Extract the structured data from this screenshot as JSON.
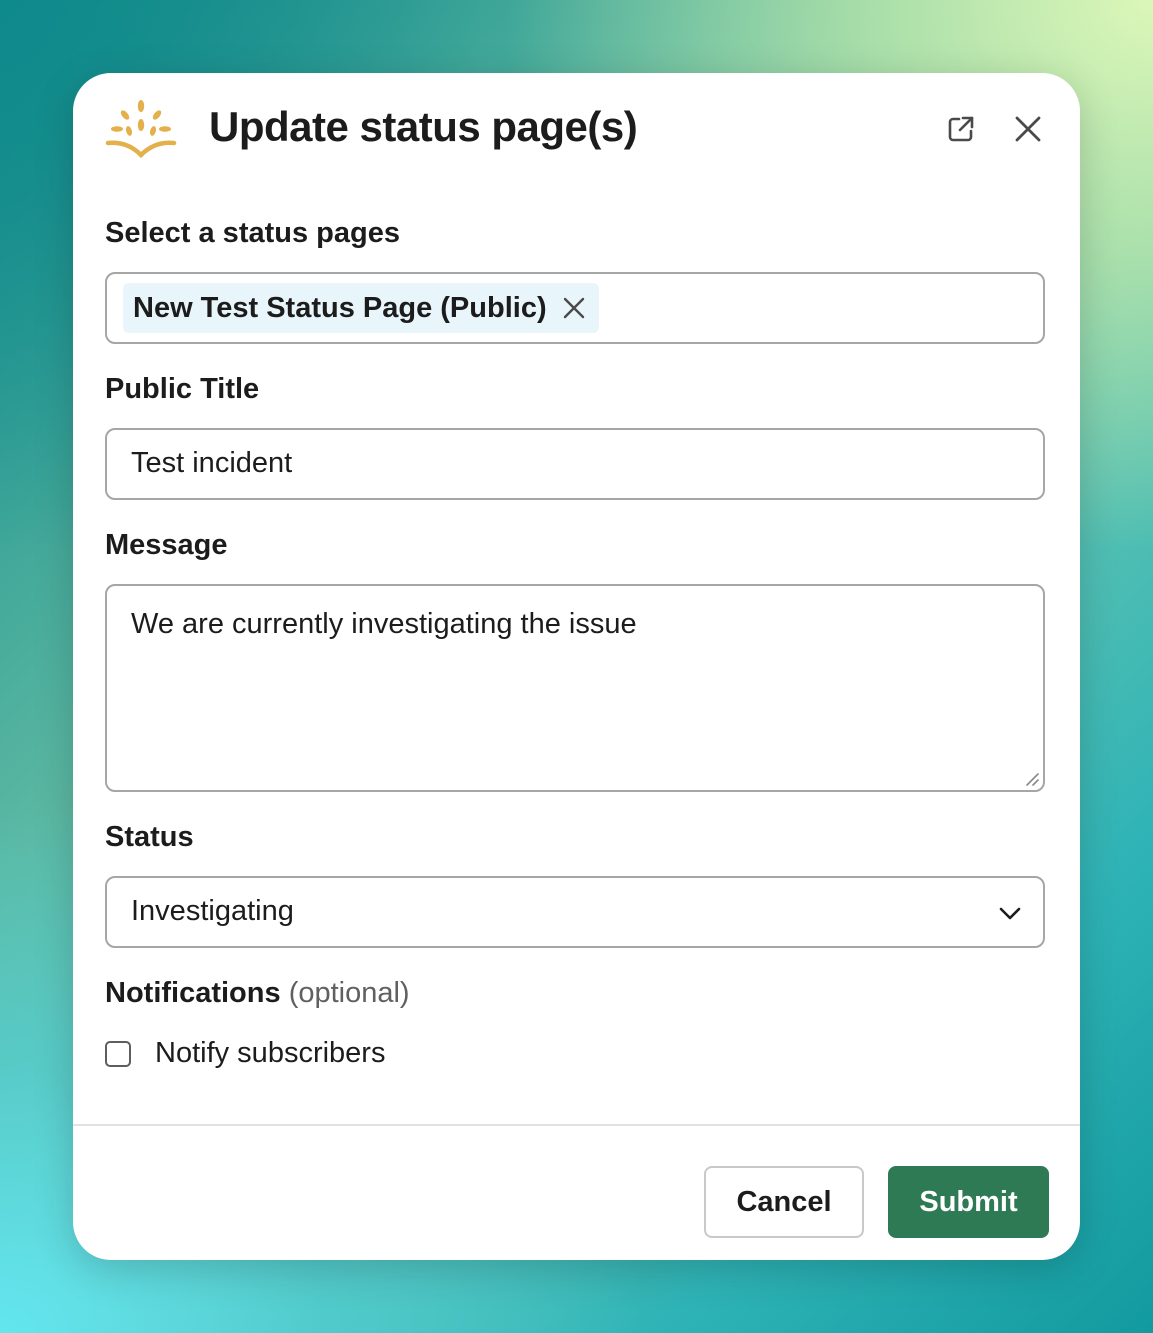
{
  "modal": {
    "title": "Update status page(s)",
    "logo_icon": "sunrise-logo-icon",
    "popout_icon": "external-link-icon",
    "close_icon": "close-icon"
  },
  "status_pages": {
    "label": "Select a status pages",
    "selected": [
      "New Test Status Page (Public)"
    ]
  },
  "public_title": {
    "label": "Public Title",
    "value": "Test incident"
  },
  "message": {
    "label": "Message",
    "value": "We are currently investigating the issue"
  },
  "status": {
    "label": "Status",
    "selected": "Investigating"
  },
  "notifications": {
    "label": "Notifications",
    "optional": "(optional)",
    "notify_label": "Notify subscribers",
    "notify_checked": false
  },
  "footer": {
    "cancel_label": "Cancel",
    "submit_label": "Submit"
  },
  "colors": {
    "primary_button": "#2e7a55",
    "chip_background": "#e8f5fa",
    "logo": "#e3b04b"
  }
}
